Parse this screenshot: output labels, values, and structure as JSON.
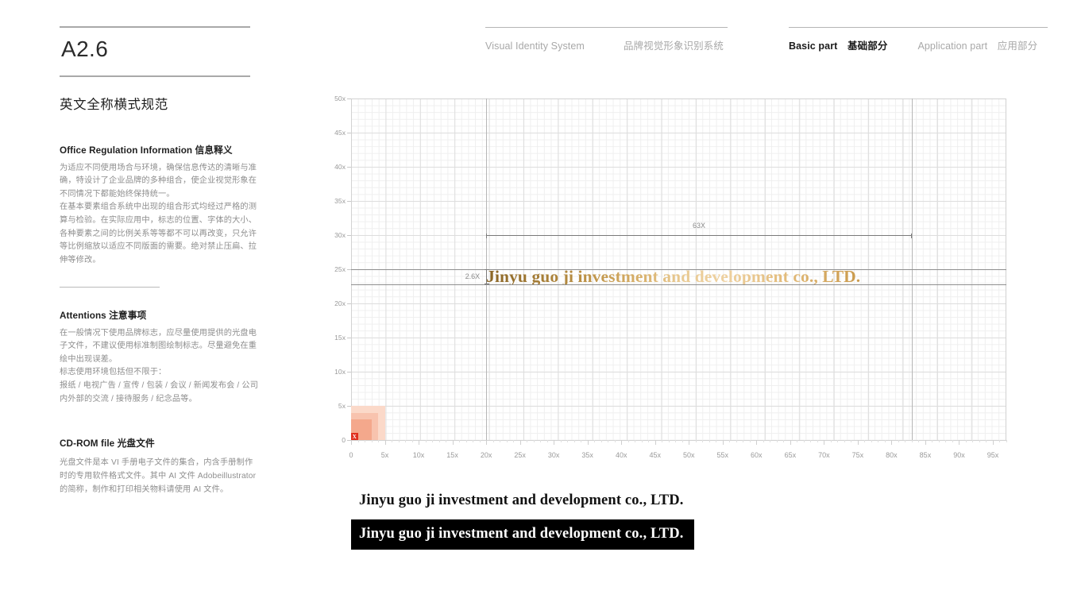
{
  "header": {
    "left": [
      {
        "en": "Visual Identity System",
        "cn": "品牌视觉形象识别系统"
      }
    ],
    "right": [
      {
        "en": "Basic part",
        "cn": "基础部分",
        "active": true
      },
      {
        "en": "Application part",
        "cn": "应用部分",
        "active": false
      }
    ]
  },
  "sidebar": {
    "code": "A2.6",
    "title": "英文全称横式规范",
    "blocks": [
      {
        "heading_en": "Office Regulation Information",
        "heading_cn": "信息释义",
        "paragraphs": [
          "为适应不同使用场合与环境，确保信息传达的清晰与准确，特设计了企业品牌的多种组合，使企业视觉形象在不同情况下都能始终保持统一。",
          "在基本要素组合系统中出现的组合形式均经过严格的测算与检验。在实际应用中，标志的位置、字体的大小、各种要素之间的比例关系等等都不可以再改变，只允许等比例缩放以适应不同版面的需要。绝对禁止压扁、拉伸等修改。"
        ]
      },
      {
        "heading_en": "Attentions",
        "heading_cn": "注意事项",
        "paragraphs": [
          "在一般情况下使用品牌标志，应尽量使用提供的光盘电子文件，不建议使用标准制图绘制标志。尽量避免在重绘中出现误差。",
          "标志使用环境包括但不限于：",
          "报纸 / 电视广告 / 宣传 / 包装 / 会议 / 新闻发布会 / 公司内外部的交流 / 接待服务 / 纪念品等。"
        ]
      },
      {
        "heading_en": "CD-ROM file",
        "heading_cn": "光盘文件",
        "paragraphs": [
          "光盘文件是本 VI 手册电子文件的集合，内含手册制作时的专用软件格式文件。其中 AI 文件 Adobeillustrator 的简称，制作和打印相关物料请使用 AI 文件。"
        ]
      }
    ]
  },
  "logo": {
    "text": "Jinyu guo ji investment and development co., LTD.",
    "x_marker": "X"
  },
  "specimens": [
    {
      "text": "Jinyu guo ji investment and development co., LTD.",
      "variant": "black-on-white"
    },
    {
      "text": "Jinyu guo ji investment and development co., LTD.",
      "variant": "white-on-black"
    }
  ],
  "chart_data": {
    "type": "scatter",
    "title": "",
    "xlabel": "",
    "ylabel": "",
    "xlim": [
      0,
      97
    ],
    "ylim": [
      0,
      50
    ],
    "grid": true,
    "grid_minor_step": 1,
    "grid_major_step": 5,
    "xticks": [
      0,
      5,
      10,
      15,
      20,
      25,
      30,
      35,
      40,
      45,
      50,
      55,
      60,
      65,
      70,
      75,
      80,
      85,
      90,
      95
    ],
    "xticklabels": [
      "0",
      "5x",
      "10x",
      "15x",
      "20x",
      "25x",
      "30x",
      "35x",
      "40x",
      "45x",
      "50x",
      "55x",
      "60x",
      "65x",
      "70x",
      "75x",
      "80x",
      "85x",
      "90x",
      "95x"
    ],
    "yticks": [
      0,
      5,
      10,
      15,
      20,
      25,
      30,
      35,
      40,
      45,
      50
    ],
    "yticklabels": [
      "0",
      "5x",
      "10x",
      "15x",
      "20x",
      "25x",
      "30x",
      "35x",
      "40x",
      "45x",
      "50x"
    ],
    "vertical_guides": [
      20,
      83
    ],
    "horizontal_guides": [
      25,
      22.8
    ],
    "annotations": [
      {
        "label": "63X",
        "type": "horizontal-dimension",
        "x_from": 20,
        "x_to": 83,
        "y": 30
      },
      {
        "label": "2.6X",
        "type": "vertical-dimension",
        "x": 20,
        "y_from": 22.8,
        "y_to": 25
      }
    ],
    "logo_placement": {
      "x_from": 20,
      "x_to": 83,
      "y_baseline": 22.8,
      "y_cap": 25
    },
    "unit_squares": [
      {
        "size": 5,
        "color": "#fbd9c9"
      },
      {
        "size": 4,
        "color": "#f8c3ae"
      },
      {
        "size": 3,
        "color": "#f4a88c"
      },
      {
        "size": 1,
        "color": "#e0301e",
        "label": "X"
      }
    ]
  },
  "colors": {
    "accent_gold_dark": "#8a6525",
    "accent_gold_light": "#eed1a0",
    "marker_red": "#e0301e",
    "grid_minor": "#efefef",
    "grid_major": "#dedede",
    "text_muted": "#9a9a9a"
  }
}
